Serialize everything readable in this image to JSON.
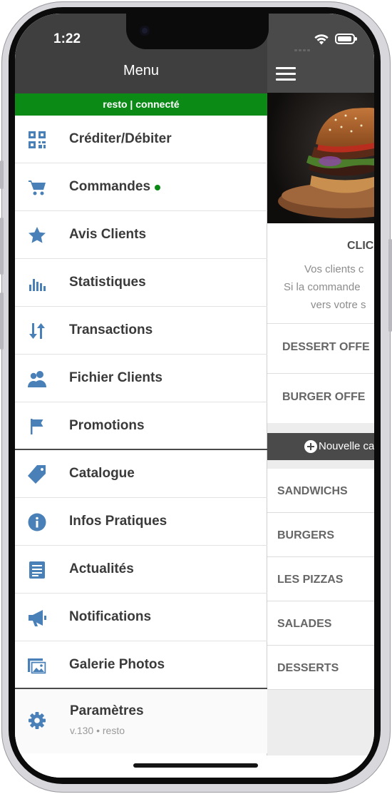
{
  "status_bar": {
    "time": "1:22"
  },
  "menu": {
    "title": "Menu",
    "connection_status": "resto | connecté",
    "items": [
      {
        "label": "Créditer/Débiter",
        "icon": "qr-code-icon"
      },
      {
        "label": "Commandes",
        "icon": "cart-icon",
        "indicator": "green-dot"
      },
      {
        "label": "Avis Clients",
        "icon": "star-icon"
      },
      {
        "label": "Statistiques",
        "icon": "bar-chart-icon"
      },
      {
        "label": "Transactions",
        "icon": "transfer-arrows-icon"
      },
      {
        "label": "Fichier Clients",
        "icon": "users-icon"
      },
      {
        "label": "Promotions",
        "icon": "flag-icon"
      },
      {
        "label": "Catalogue",
        "icon": "tag-icon"
      },
      {
        "label": "Infos Pratiques",
        "icon": "info-icon"
      },
      {
        "label": "Actualités",
        "icon": "news-icon"
      },
      {
        "label": "Notifications",
        "icon": "megaphone-icon"
      },
      {
        "label": "Galerie Photos",
        "icon": "photo-gallery-icon"
      }
    ],
    "settings": {
      "label": "Paramètres",
      "version": "v.130 • resto",
      "icon": "gear-icon"
    }
  },
  "content": {
    "promo": {
      "title": "CLIC",
      "line1": "Vos clients c",
      "line2": "Si la commande",
      "line3": "vers votre s"
    },
    "offers": [
      {
        "label": "DESSERT OFFE"
      },
      {
        "label": "BURGER OFFE"
      }
    ],
    "new_category_label": "Nouvelle ca",
    "categories": [
      {
        "label": "SANDWICHS"
      },
      {
        "label": "BURGERS"
      },
      {
        "label": "LES PIZZAS"
      },
      {
        "label": "SALADES"
      },
      {
        "label": "DESSERTS"
      }
    ]
  },
  "colors": {
    "accent_icon": "#4a80b8",
    "header_dark": "#3f3f3f",
    "connected_green": "#0b8a16"
  }
}
